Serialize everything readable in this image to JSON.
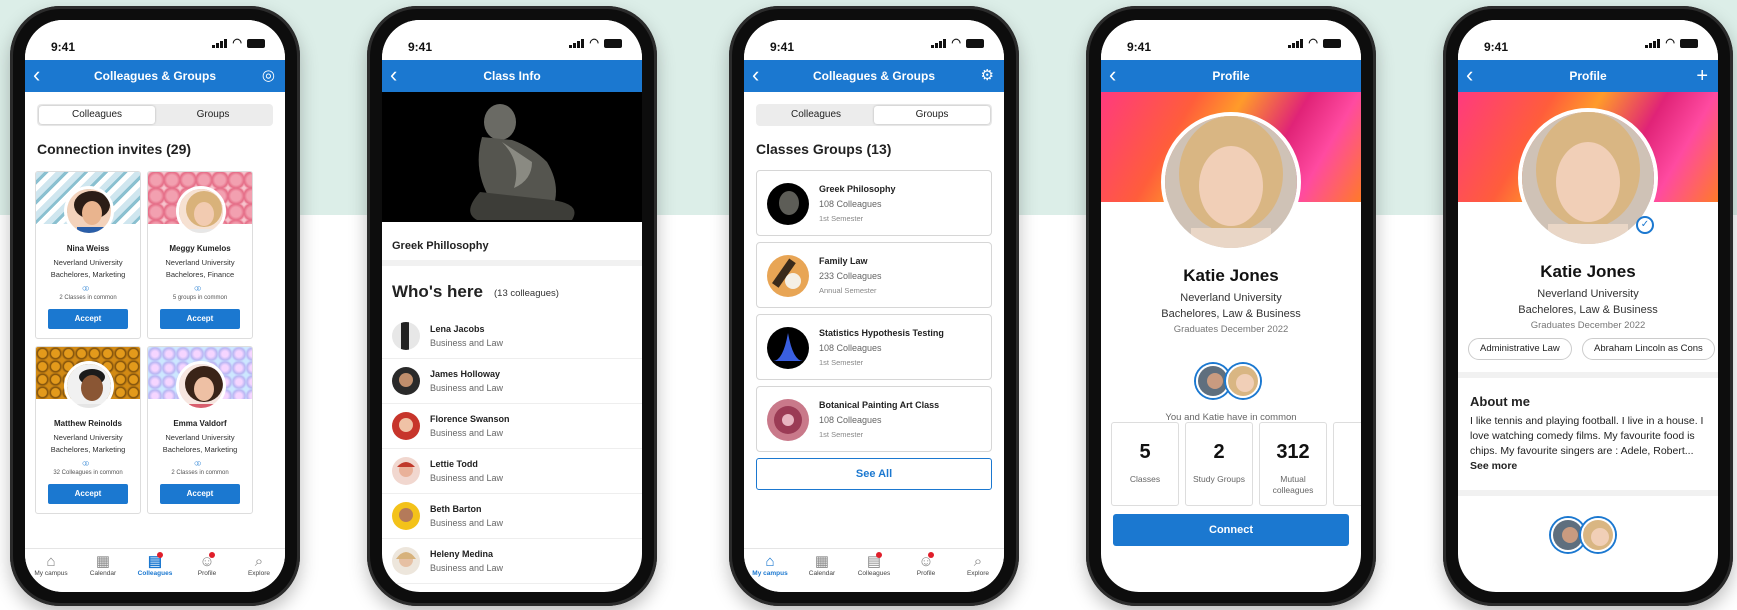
{
  "status": {
    "time": "9:41"
  },
  "phone1": {
    "title": "Colleagues & Groups",
    "tabs": [
      "Colleagues",
      "Groups"
    ],
    "heading": "Connection invites (29)",
    "cards": [
      {
        "name": "Nina Weiss",
        "school": "Neverland University",
        "degree": "Bachelores, Marketing",
        "common": "2 Classes in common",
        "accept": "Accept"
      },
      {
        "name": "Meggy Kumelos",
        "school": "Neverland University",
        "degree": "Bachelores, Finance",
        "common": "5 groups in common",
        "accept": "Accept"
      },
      {
        "name": "Matthew Reinolds",
        "school": "Neverland University",
        "degree": "Bachelores, Marketing",
        "common": "32  Colleagues in common",
        "accept": "Accept"
      },
      {
        "name": "Emma Valdorf",
        "school": "Neverland University",
        "degree": "Bachelores, Marketing",
        "common": "2 Classes in common",
        "accept": "Accept"
      }
    ]
  },
  "tabbar": [
    "My campus",
    "Calendar",
    "Colleagues",
    "Profile",
    "Explore"
  ],
  "phone2": {
    "title": "Class Info",
    "class_name": "Greek Phillosophy",
    "heading": "Who's here",
    "count": "(13 colleagues)",
    "people": [
      {
        "name": "Lena Jacobs",
        "sub": "Business and Law"
      },
      {
        "name": "James Holloway",
        "sub": "Business and Law"
      },
      {
        "name": "Florence Swanson",
        "sub": "Business and Law"
      },
      {
        "name": "Lettie Todd",
        "sub": "Business and Law"
      },
      {
        "name": "Beth Barton",
        "sub": "Business and Law"
      },
      {
        "name": "Heleny Medina",
        "sub": "Business and Law"
      }
    ]
  },
  "phone3": {
    "title": "Colleagues & Groups",
    "tabs": [
      "Colleagues",
      "Groups"
    ],
    "heading": "Classes Groups (13)",
    "groups": [
      {
        "name": "Greek Philosophy",
        "colleagues": "108 Colleagues",
        "term": "1st Semester"
      },
      {
        "name": "Family Law",
        "colleagues": "233 Colleagues",
        "term": "Annual Semester"
      },
      {
        "name": "Statistics Hypothesis Testing",
        "colleagues": "108 Colleagues",
        "term": "1st Semester"
      },
      {
        "name": "Botanical Painting Art Class",
        "colleagues": "108 Colleagues",
        "term": "1st Semester"
      }
    ],
    "see_all": "See All"
  },
  "phone4": {
    "title": "Profile",
    "name": "Katie Jones",
    "school": "Neverland University",
    "degree": "Bachelores, Law & Business",
    "grad": "Graduates December 2022",
    "common": "You and Katie have in common",
    "stats": [
      {
        "value": "5",
        "label": "Classes"
      },
      {
        "value": "2",
        "label": "Study Groups"
      },
      {
        "value": "312",
        "label": "Mutual colleagues"
      }
    ],
    "connect": "Connect"
  },
  "phone5": {
    "title": "Profile",
    "name": "Katie Jones",
    "school": "Neverland University",
    "degree": "Bachelores, Law & Business",
    "grad": "Graduates December 2022",
    "chips": [
      "Administrative Law",
      "Abraham Lincoln as Cons"
    ],
    "about_title": "About me",
    "about_text": "I like tennis and playing football. I live in a house. I love watching comedy films. My favourite food is chips. My favourite singers are : Adele, Robert...",
    "see_more": "See more"
  },
  "colors": {
    "primary": "#1b78d0",
    "band": "#dceee8",
    "badge": "#e01e2a"
  }
}
